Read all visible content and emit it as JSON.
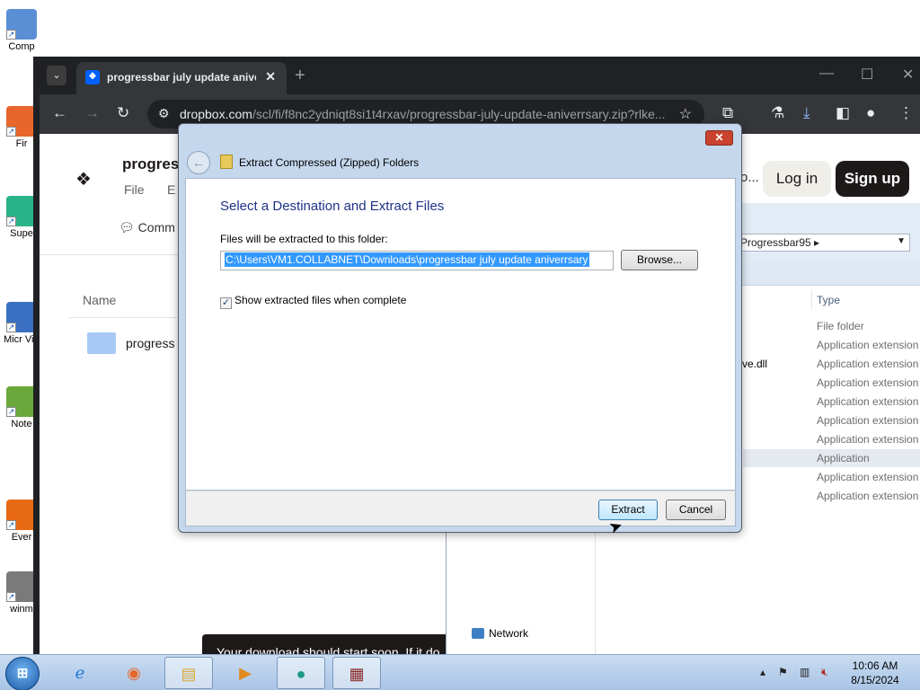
{
  "desktop": {
    "icons": [
      {
        "label": "Comp",
        "color": "#5a8fd6"
      },
      {
        "label": "Fir",
        "color": "#e8662b"
      },
      {
        "label": "Supe",
        "color": "#2bb38a"
      },
      {
        "label": "Micr Visual",
        "color": "#3b6fc2"
      },
      {
        "label": "Note",
        "color": "#6ba83b"
      },
      {
        "label": "Ever",
        "color": "#e86a14"
      },
      {
        "label": "winm",
        "color": "#7a7a7a"
      }
    ]
  },
  "chrome": {
    "tab_title": "progressbar july update aniver",
    "url_host": "dropbox.com",
    "url_path": "/scl/fi/f8nc2ydniqt8si1t4rxav/progressbar-july-update-aniverrsary.zip?rlke..."
  },
  "dropbox": {
    "title": "progress",
    "menu": [
      "File",
      "E"
    ],
    "comment": "Comm",
    "name_header": "Name",
    "folder_name": "progress",
    "more": "o...",
    "login": "Log in",
    "signup": "Sign up",
    "download_toast": "Your download should start soon. If it do"
  },
  "explorer": {
    "breadcrumb": "Progressbar95",
    "type_header": "Type",
    "partial_name": "tive.dll",
    "network": "Network",
    "types": [
      "File folder",
      "Application extension",
      "Application extension",
      "Application extension",
      "Application extension",
      "Application extension",
      "Application extension",
      "Application",
      "Application extension",
      "Application extension"
    ]
  },
  "dialog": {
    "window_title": "Extract Compressed (Zipped) Folders",
    "heading": "Select a Destination and Extract Files",
    "folder_label": "Files will be extracted to this folder:",
    "path_value": "C:\\Users\\VM1.COLLABNET\\Downloads\\progressbar july update aniverrsary",
    "browse": "Browse...",
    "checkbox_label": "Show extracted files when complete",
    "checkbox_checked": true,
    "extract": "Extract",
    "cancel": "Cancel"
  },
  "taskbar": {
    "time": "10:06 AM",
    "date": "8/15/2024"
  }
}
